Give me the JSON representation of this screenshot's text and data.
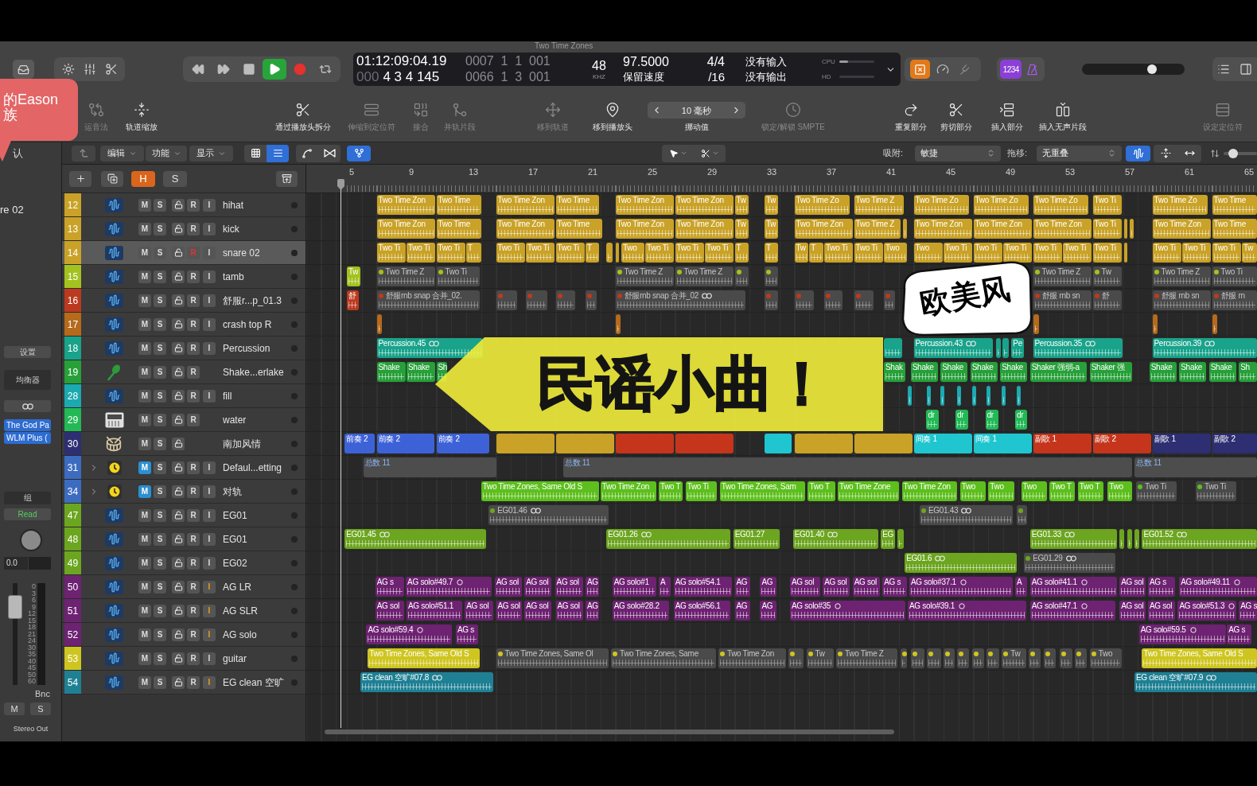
{
  "window": {
    "title": "Two Time Zones"
  },
  "control_bar": {
    "transport": [
      {
        "on": false
      },
      {
        "on": false
      },
      {
        "on": false
      },
      {
        "on": true
      },
      {
        "on": false
      },
      {
        "on": false
      }
    ],
    "lcd": {
      "time": "01:12:09:04.19",
      "position_dim": "000",
      "position": "4 3 4 145",
      "locators": [
        "0007  1  1  001",
        "0066  1  3  001"
      ],
      "sample_rate": "48",
      "sample_rate_unit": "KHZ",
      "tempo": "97.5000",
      "tempo_mode": "保留速度",
      "signature": "4/4",
      "division": "/16",
      "input": "没有输入",
      "output": "没有输出",
      "cpu": {
        "label": "CPU",
        "level": 0.25
      },
      "hd": {
        "label": "HD"
      }
    },
    "modes": [
      {
        "on": true
      },
      {
        "on": false
      },
      {
        "on": false
      }
    ],
    "count_in": {
      "label": "1234",
      "on": true
    },
    "metronome": {
      "on": true
    },
    "master_volume": {
      "level": 0.7
    }
  },
  "toolbar": [
    {
      "kind": "button",
      "label": "运音法",
      "disabled": true
    },
    {
      "kind": "button",
      "label": "轨道缩放",
      "disabled": false
    },
    {
      "kind": "button",
      "label": "通过播放头拆分",
      "disabled": false
    },
    {
      "kind": "button",
      "label": "伸缩到定位符",
      "disabled": true
    },
    {
      "kind": "button",
      "label": "接合",
      "disabled": true
    },
    {
      "kind": "button",
      "label": "并轨片段",
      "disabled": true
    },
    {
      "kind": "button",
      "label": "移到轨道",
      "disabled": true
    },
    {
      "kind": "button",
      "label": "移到播放头",
      "disabled": false
    },
    {
      "kind": "stepper",
      "value": "10 毫秒",
      "label": "挪动值"
    },
    {
      "kind": "button",
      "label": "锁定/解锁 SMPTE",
      "disabled": true
    },
    {
      "kind": "button",
      "label": "重复部分",
      "disabled": false
    },
    {
      "kind": "button",
      "label": "剪切部分",
      "disabled": false
    },
    {
      "kind": "button",
      "label": "插入部分",
      "disabled": false
    },
    {
      "kind": "button",
      "label": "插入无声片段",
      "disabled": false
    },
    {
      "kind": "button",
      "label": "设定定位符",
      "disabled": true
    }
  ],
  "edit_bar": {
    "menus": [
      "编辑",
      "功能",
      "显示"
    ],
    "views": [
      {
        "selected": false
      },
      {
        "selected": true
      }
    ],
    "catch": {
      "on": true
    },
    "snap_label": "吸附:",
    "snap": "敏捷",
    "drag_label": "拖移:",
    "drag": "无重叠",
    "waveform_zoom": {
      "on": true
    },
    "zoom": {
      "level": 0.2
    }
  },
  "inspector": {
    "title": "认",
    "track": "re 02",
    "settings": "设置",
    "eq": "均衡器",
    "plugins": [
      "The God Pa",
      "WLM Plus ("
    ],
    "group": "组",
    "automation": "Read",
    "volume": "0.0",
    "fader": {
      "level": 0.85
    },
    "scale": [
      "0",
      "3",
      "6",
      "9",
      "12",
      "15",
      "18",
      "21",
      "24",
      "30",
      "35",
      "40",
      "45",
      "50",
      "60"
    ],
    "bounce": "Bnc",
    "mute": {
      "label": "M",
      "on": false
    },
    "solo": {
      "label": "S",
      "on": false
    },
    "output": "Stereo Out"
  },
  "list_header": {
    "buttons": [
      {
        "label": "H",
        "on": true
      },
      {
        "label": "S",
        "on": false
      }
    ]
  },
  "ruler": [
    "5",
    "9",
    "13",
    "17",
    "21",
    "25",
    "29",
    "33",
    "37",
    "41",
    "45",
    "49",
    "53",
    "57",
    "61",
    "65"
  ],
  "tracks": [
    {
      "number": "12",
      "name": "hihat",
      "kind": "audio",
      "color": "#c9a227",
      "selected": false,
      "mute": {
        "label": "M",
        "on": false
      },
      "solo": {
        "label": "S",
        "on": false
      },
      "record": {
        "label": "R",
        "on": false
      },
      "input": {
        "label": "I",
        "on": false
      },
      "regions": [
        {
          "label": "Two Time Zon",
          "muted": false
        },
        {
          "label": "Two Time",
          "muted": false
        },
        {
          "label": "Two Time Zon",
          "muted": false
        },
        {
          "label": "Two Time",
          "muted": false
        },
        {
          "label": "Two Time Zon",
          "muted": false
        },
        {
          "label": "Two Time Zon",
          "muted": false
        },
        {
          "label": "Tw",
          "muted": false
        },
        {
          "label": "Tw",
          "muted": false
        },
        {
          "label": "Two Time Zo",
          "muted": false
        },
        {
          "label": "Two Time Z",
          "muted": false
        },
        {
          "label": "Two Time Zo",
          "muted": false
        },
        {
          "label": "Two Time Zo",
          "muted": false
        },
        {
          "label": "Two Time Zo",
          "muted": false
        },
        {
          "label": "Two Ti",
          "muted": false
        },
        {
          "label": "Two Time Zo",
          "muted": false
        },
        {
          "label": "Two Time",
          "muted": false
        }
      ]
    },
    {
      "number": "13",
      "name": "kick",
      "kind": "audio",
      "color": "#c9a227",
      "selected": false,
      "mute": {
        "label": "M",
        "on": false
      },
      "solo": {
        "label": "S",
        "on": false
      },
      "record": {
        "label": "R",
        "on": false
      },
      "input": {
        "label": "I",
        "on": false
      },
      "regions": [
        {
          "label": "Two Time Zon",
          "muted": false
        },
        {
          "label": "Two Time",
          "muted": false
        },
        {
          "label": "Two Time Zon",
          "muted": false
        },
        {
          "label": "Two Time",
          "muted": false
        },
        {
          "label": "Two Time Zon",
          "muted": false
        },
        {
          "label": "Two Time Zon",
          "muted": false
        },
        {
          "label": "Tw",
          "muted": false
        },
        {
          "label": "Tw",
          "muted": false
        },
        {
          "label": "Two Time Zon",
          "muted": false
        },
        {
          "label": "Two Time Z",
          "muted": false
        },
        {
          "muted": false
        },
        {
          "label": "Two Time Zon",
          "muted": false
        },
        {
          "label": "Two Time Zon",
          "muted": false
        },
        {
          "label": "Two Time Zon",
          "muted": false
        },
        {
          "label": "Two Ti",
          "muted": false
        },
        {
          "muted": false
        },
        {
          "muted": false
        },
        {
          "label": "Two Time Zon",
          "muted": false
        },
        {
          "label": "Two Time",
          "muted": false
        }
      ]
    },
    {
      "number": "14",
      "name": "snare 02",
      "kind": "audio",
      "color": "#c9a227",
      "selected": true,
      "mute": {
        "label": "M",
        "on": false
      },
      "solo": {
        "label": "S",
        "on": false
      },
      "record": {
        "label": "R",
        "on": true
      },
      "input": {
        "label": "I",
        "on": false
      },
      "regions": [
        {
          "label": "Two Ti",
          "muted": false
        },
        {
          "label": "Two Ti",
          "muted": false
        },
        {
          "label": "Two Ti",
          "muted": false
        },
        {
          "label": "T",
          "muted": false
        },
        {
          "label": "Two Ti",
          "muted": false
        },
        {
          "label": "Two Ti",
          "muted": false
        },
        {
          "label": "Two Ti",
          "muted": false
        },
        {
          "label": "T",
          "muted": false
        },
        {
          "muted": false
        },
        {
          "muted": false
        },
        {
          "label": "Two",
          "muted": false
        },
        {
          "label": "Two Ti",
          "muted": false
        },
        {
          "label": "Two Ti",
          "muted": false
        },
        {
          "label": "Two Ti",
          "muted": false
        },
        {
          "label": "T",
          "muted": false
        },
        {
          "label": "T",
          "muted": false
        },
        {
          "label": "Tw",
          "muted": false
        },
        {
          "label": "T",
          "muted": false
        },
        {
          "label": "Two Ti",
          "muted": false
        },
        {
          "label": "Two Ti",
          "muted": false
        },
        {
          "label": "Two",
          "muted": false
        },
        {
          "label": "Two",
          "muted": false
        },
        {
          "label": "Two Ti",
          "muted": false
        },
        {
          "label": "Two Ti",
          "muted": false
        },
        {
          "label": "Two Ti",
          "muted": false
        },
        {
          "label": "Two Ti",
          "muted": false
        },
        {
          "label": "Two Ti",
          "muted": false
        },
        {
          "label": "Two Ti",
          "muted": false
        },
        {
          "muted": false
        },
        {
          "label": "Two Ti",
          "muted": false
        },
        {
          "label": "Two Ti",
          "muted": false
        },
        {
          "label": "Two Ti",
          "muted": false
        },
        {
          "label": "Tw",
          "muted": false
        }
      ]
    },
    {
      "number": "15",
      "name": "tamb",
      "kind": "audio",
      "color": "#a3c21f",
      "selected": false,
      "mute": {
        "label": "M",
        "on": false
      },
      "solo": {
        "label": "S",
        "on": false
      },
      "record": {
        "label": "R",
        "on": false
      },
      "input": {
        "label": "I",
        "on": false
      },
      "regions": [
        {
          "label": "Tw",
          "muted": false
        },
        {
          "label": "Two Time Z",
          "muted": true
        },
        {
          "label": "Two Ti",
          "muted": true
        },
        {
          "label": "Two Time Z",
          "muted": true
        },
        {
          "label": "Two Time Z",
          "muted": true
        },
        {
          "muted": true
        },
        {
          "muted": true
        },
        {
          "label": "Two Time Z",
          "muted": true
        },
        {
          "label": "Tw",
          "muted": true
        },
        {
          "label": "Two Time Z",
          "muted": true
        },
        {
          "label": "Two Ti",
          "muted": true
        }
      ]
    },
    {
      "number": "16",
      "name": "舒服r...p_01.3",
      "kind": "audio",
      "color": "#bb3a1f",
      "selected": false,
      "mute": {
        "label": "M",
        "on": false
      },
      "solo": {
        "label": "S",
        "on": false
      },
      "record": {
        "label": "R",
        "on": false
      },
      "input": {
        "label": "I",
        "on": false
      },
      "regions": [
        {
          "label": "舒",
          "muted": false
        },
        {
          "label": "舒服rnb snap 合并_02.",
          "muted": true
        },
        {
          "muted": true
        },
        {
          "muted": true
        },
        {
          "muted": true
        },
        {
          "muted": true
        },
        {
          "label": "舒服rnb snap 合并_02",
          "muted": true,
          "double_ring": true
        },
        {
          "muted": true
        },
        {
          "muted": true
        },
        {
          "muted": true
        },
        {
          "muted": true
        },
        {
          "muted": true
        },
        {
          "label": "舒服 rnb sn",
          "muted": true
        },
        {
          "label": "舒",
          "muted": true
        },
        {
          "label": "舒服 rnb sn",
          "muted": true
        },
        {
          "label": "舒服 rn",
          "muted": true
        }
      ]
    },
    {
      "number": "17",
      "name": "crash top R",
      "kind": "audio",
      "color": "#b56a1c",
      "selected": false,
      "mute": {
        "label": "M",
        "on": false
      },
      "solo": {
        "label": "S",
        "on": false
      },
      "record": {
        "label": "R",
        "on": false
      },
      "input": {
        "label": "I",
        "on": false
      },
      "regions": [
        {
          "muted": false
        },
        {
          "muted": false
        },
        {
          "muted": false
        },
        {
          "muted": false
        },
        {
          "muted": false
        }
      ]
    },
    {
      "number": "18",
      "name": "Percussion",
      "kind": "audio",
      "color": "#19a38b",
      "selected": false,
      "mute": {
        "label": "M",
        "on": false
      },
      "solo": {
        "label": "S",
        "on": false
      },
      "record": {
        "label": "R",
        "on": false
      },
      "input": {
        "label": "I",
        "on": false
      },
      "regions": [
        {
          "label": "Percussion.45",
          "muted": false,
          "double_ring": true
        },
        {
          "muted": false
        },
        {
          "label": "Percussion.43",
          "muted": false,
          "double_ring": true
        },
        {
          "muted": false
        },
        {
          "muted": false
        },
        {
          "label": "Pe",
          "muted": false
        },
        {
          "label": "Percussion.35",
          "muted": false,
          "double_ring": true
        },
        {
          "label": "Percussion.39",
          "muted": false,
          "double_ring": true
        }
      ]
    },
    {
      "number": "19",
      "name": "Shake...erlake",
      "kind": "shaker",
      "color": "#27a03a",
      "selected": false,
      "mute": {
        "label": "M",
        "on": false
      },
      "solo": {
        "label": "S",
        "on": false
      },
      "record": {
        "label": "R",
        "on": false
      },
      "regions": [
        {
          "label": "Shake",
          "muted": false
        },
        {
          "label": "Shake",
          "muted": false
        },
        {
          "label": "Sh",
          "muted": false
        },
        {
          "label": "Shak",
          "muted": false
        },
        {
          "label": "Shake",
          "muted": false
        },
        {
          "label": "Shake",
          "muted": false
        },
        {
          "label": "Shake",
          "muted": false
        },
        {
          "label": "Shake",
          "muted": false
        },
        {
          "label": "Shaker 强弱-a",
          "muted": false
        },
        {
          "label": "Shaker 强",
          "muted": false
        },
        {
          "label": "Shake",
          "muted": false
        },
        {
          "label": "Shake",
          "muted": false
        },
        {
          "label": "Shake",
          "muted": false
        },
        {
          "label": "Sh",
          "muted": false
        }
      ]
    },
    {
      "number": "28",
      "name": "fill",
      "kind": "audio",
      "color": "#1aaab0",
      "selected": false,
      "mute": {
        "label": "M",
        "on": false
      },
      "solo": {
        "label": "S",
        "on": false
      },
      "record": {
        "label": "R",
        "on": false
      },
      "input": {
        "label": "I",
        "on": false
      },
      "regions": [
        {
          "muted": false
        },
        {
          "muted": false
        },
        {
          "muted": false
        },
        {
          "muted": false
        },
        {
          "muted": false
        },
        {
          "muted": false
        },
        {
          "muted": false
        },
        {
          "muted": false
        }
      ]
    },
    {
      "number": "29",
      "name": "water",
      "kind": "sampler",
      "color": "#22b956",
      "selected": false,
      "mute": {
        "label": "M",
        "on": false
      },
      "solo": {
        "label": "S",
        "on": false
      },
      "record": {
        "label": "R",
        "on": false
      },
      "regions": [
        {
          "label": "dr",
          "muted": false
        },
        {
          "label": "dr",
          "muted": false
        },
        {
          "label": "dr",
          "muted": false
        },
        {
          "label": "dr",
          "muted": false
        }
      ]
    },
    {
      "number": "30",
      "name": "南加风情",
      "kind": "drummer",
      "color": "#2e2e72",
      "selected": false,
      "mute": {
        "label": "M",
        "on": false
      },
      "solo": {
        "label": "S",
        "on": false
      },
      "regions": [
        {
          "label": "前奏 2",
          "muted": false,
          "color": "#3d62d8"
        },
        {
          "label": "前奏 2",
          "muted": false,
          "color": "#3d62d8"
        },
        {
          "label": "前奏 2",
          "muted": false,
          "color": "#3d62d8"
        },
        {
          "muted": false,
          "color": "#c9a227"
        },
        {
          "muted": false,
          "color": "#c9a227"
        },
        {
          "muted": false,
          "color": "#c4351c"
        },
        {
          "muted": false,
          "color": "#c4351c"
        },
        {
          "muted": false,
          "color": "#1fc6cf"
        },
        {
          "muted": false,
          "color": "#c9a227"
        },
        {
          "muted": false,
          "color": "#c9a227"
        },
        {
          "label": "间奏 1",
          "muted": false,
          "color": "#1fc6cf"
        },
        {
          "label": "间奏 1",
          "muted": false,
          "color": "#1fc6cf"
        },
        {
          "label": "副歌 1",
          "muted": false,
          "color": "#c4351c"
        },
        {
          "label": "副歌 2",
          "muted": false,
          "color": "#c4351c"
        },
        {
          "label": "副歌 1",
          "muted": false,
          "color": "#2e2e72"
        },
        {
          "label": "副歌 2",
          "muted": false,
          "color": "#2e2e72"
        }
      ]
    },
    {
      "number": "31",
      "name": "Defaul...etting",
      "kind": "folder",
      "color": "#3c6cc0",
      "selected": false,
      "expanded": false,
      "mute": {
        "label": "M",
        "on": true
      },
      "solo": {
        "label": "S",
        "on": false
      },
      "record": {
        "label": "R",
        "on": false
      },
      "input": {
        "label": "I",
        "on": false
      },
      "regions": [
        {
          "label": "总数 11",
          "muted": false
        },
        {
          "label": "总数 11",
          "muted": false
        },
        {
          "label": "总数 11",
          "muted": false
        }
      ]
    },
    {
      "number": "34",
      "name": "对轨",
      "kind": "summing",
      "color": "#3c6cc0",
      "selected": false,
      "expanded": false,
      "mute": {
        "label": "M",
        "on": true
      },
      "solo": {
        "label": "S",
        "on": false
      },
      "record": {
        "label": "R",
        "on": false
      },
      "input": {
        "label": "I",
        "on": false
      },
      "regions": [
        {
          "label": "Two Time Zones, Same Old S",
          "muted": false,
          "color": "#5dbf1d"
        },
        {
          "label": "Two Time Zon",
          "muted": false,
          "color": "#5dbf1d"
        },
        {
          "label": "Two T",
          "muted": false,
          "color": "#5dbf1d"
        },
        {
          "label": "Two Ti",
          "muted": false,
          "color": "#5dbf1d"
        },
        {
          "label": "Two Time Zones, Sam",
          "muted": false,
          "color": "#5dbf1d"
        },
        {
          "label": "Two T",
          "muted": false,
          "color": "#5dbf1d"
        },
        {
          "label": "Two Time Zone",
          "muted": false,
          "color": "#5dbf1d"
        },
        {
          "label": "Two Time Zon",
          "muted": false,
          "color": "#5dbf1d"
        },
        {
          "label": "Two",
          "muted": false,
          "color": "#5dbf1d"
        },
        {
          "label": "Two",
          "muted": false,
          "color": "#5dbf1d"
        },
        {
          "label": "Two",
          "muted": false,
          "color": "#5dbf1d"
        },
        {
          "label": "Two T",
          "muted": false,
          "color": "#5dbf1d"
        },
        {
          "label": "Two T",
          "muted": false,
          "color": "#5dbf1d"
        },
        {
          "label": "Two",
          "muted": false,
          "color": "#5dbf1d"
        },
        {
          "label": "Two Ti",
          "muted": true,
          "color": "#5dbf1d"
        },
        {
          "label": "Two Ti",
          "muted": true,
          "color": "#5dbf1d"
        }
      ]
    },
    {
      "number": "47",
      "name": "EG01",
      "kind": "audio",
      "color": "#6ca51f",
      "selected": false,
      "mute": {
        "label": "M",
        "on": false
      },
      "solo": {
        "label": "S",
        "on": false
      },
      "record": {
        "label": "R",
        "on": false
      },
      "input": {
        "label": "I",
        "on": false
      },
      "regions": [
        {
          "label": "EG01.46",
          "muted": true,
          "double_ring": true
        },
        {
          "label": "EG01.43",
          "muted": true,
          "double_ring": true
        },
        {
          "muted": true
        }
      ]
    },
    {
      "number": "48",
      "name": "EG01",
      "kind": "audio",
      "color": "#6ca51f",
      "selected": false,
      "mute": {
        "label": "M",
        "on": false
      },
      "solo": {
        "label": "S",
        "on": false
      },
      "record": {
        "label": "R",
        "on": false
      },
      "input": {
        "label": "I",
        "on": false
      },
      "regions": [
        {
          "label": "EG01.45",
          "muted": false,
          "double_ring": true
        },
        {
          "label": "EG01.26",
          "muted": false,
          "double_ring": true
        },
        {
          "label": "EG01.27",
          "muted": false
        },
        {
          "label": "EG01.40",
          "muted": false,
          "double_ring": true
        },
        {
          "label": "EG",
          "muted": false
        },
        {
          "muted": false
        },
        {
          "label": "EG01.33",
          "muted": false,
          "double_ring": true
        },
        {
          "muted": false
        },
        {
          "muted": false
        },
        {
          "muted": false
        },
        {
          "label": "EG01.52",
          "muted": false,
          "double_ring": true
        }
      ]
    },
    {
      "number": "49",
      "name": "EG02",
      "kind": "audio",
      "color": "#6ca51f",
      "selected": false,
      "mute": {
        "label": "M",
        "on": false
      },
      "solo": {
        "label": "S",
        "on": false
      },
      "record": {
        "label": "R",
        "on": false
      },
      "input": {
        "label": "I",
        "on": false
      },
      "regions": [
        {
          "label": "EG01.6",
          "muted": false,
          "double_ring": true
        },
        {
          "label": "EG01.29",
          "muted": true,
          "double_ring": true
        }
      ]
    },
    {
      "number": "50",
      "name": "AG LR",
      "kind": "audio",
      "color": "#6e2272",
      "selected": false,
      "mute": {
        "label": "M",
        "on": false
      },
      "solo": {
        "label": "S",
        "on": false
      },
      "record": {
        "label": "R",
        "on": false
      },
      "input": {
        "label": "I",
        "on": true
      },
      "regions": [
        {
          "label": "AG s",
          "muted": false
        },
        {
          "label": "AG solo#49.7",
          "muted": false,
          "circle_mark": true
        },
        {
          "label": "AG sol",
          "muted": false
        },
        {
          "label": "AG sol",
          "muted": false
        },
        {
          "label": "AG sol",
          "muted": false
        },
        {
          "label": "AG",
          "muted": false
        },
        {
          "label": "AG solo#1",
          "muted": false
        },
        {
          "label": "A",
          "muted": false
        },
        {
          "label": "AG solo#54.1",
          "muted": false
        },
        {
          "label": "AG",
          "muted": false
        },
        {
          "label": "AG",
          "muted": false
        },
        {
          "label": "AG sol",
          "muted": false
        },
        {
          "label": "AG sol",
          "muted": false
        },
        {
          "label": "AG sol",
          "muted": false
        },
        {
          "label": "AG s",
          "muted": false
        },
        {
          "label": "AG solo#37.1",
          "muted": false,
          "circle_mark": true
        },
        {
          "label": "A",
          "muted": false
        },
        {
          "label": "AG solo#41.1",
          "muted": false,
          "circle_mark": true
        },
        {
          "label": "AG sol",
          "muted": false
        },
        {
          "label": "AG s",
          "muted": false
        },
        {
          "label": "AG solo#49.11",
          "muted": false,
          "circle_mark": true
        }
      ]
    },
    {
      "number": "51",
      "name": "AG SLR",
      "kind": "audio",
      "color": "#6e2272",
      "selected": false,
      "mute": {
        "label": "M",
        "on": false
      },
      "solo": {
        "label": "S",
        "on": false
      },
      "record": {
        "label": "R",
        "on": false
      },
      "input": {
        "label": "I",
        "on": true
      },
      "regions": [
        {
          "label": "AG sol",
          "muted": false
        },
        {
          "label": "AG solo#51.1",
          "muted": false
        },
        {
          "label": "AG sol",
          "muted": false
        },
        {
          "label": "AG sol",
          "muted": false
        },
        {
          "label": "AG sol",
          "muted": false
        },
        {
          "label": "AG sol",
          "muted": false
        },
        {
          "label": "AG",
          "muted": false
        },
        {
          "label": "AG solo#28.2",
          "muted": false
        },
        {
          "label": "AG solo#56.1",
          "muted": false
        },
        {
          "label": "AG",
          "muted": false
        },
        {
          "label": "AG",
          "muted": false
        },
        {
          "label": "AG solo#35",
          "muted": false,
          "circle_mark": true
        },
        {
          "label": "AG solo#39.1",
          "muted": false,
          "circle_mark": true
        },
        {
          "label": "AG solo#47.1",
          "muted": false,
          "circle_mark": true
        },
        {
          "label": "AG sol",
          "muted": false
        },
        {
          "label": "AG sol",
          "muted": false
        },
        {
          "label": "AG solo#51.3",
          "muted": false,
          "circle_mark": true
        },
        {
          "label": "AG s",
          "muted": false
        }
      ]
    },
    {
      "number": "52",
      "name": "AG solo",
      "kind": "audio",
      "color": "#6e2272",
      "selected": false,
      "mute": {
        "label": "M",
        "on": false
      },
      "solo": {
        "label": "S",
        "on": false
      },
      "record": {
        "label": "R",
        "on": false
      },
      "input": {
        "label": "I",
        "on": true
      },
      "regions": [
        {
          "label": "AG solo#59.4",
          "muted": false,
          "circle_mark": true
        },
        {
          "label": "AG s",
          "muted": false
        },
        {
          "label": "AG solo#59.5",
          "muted": false,
          "circle_mark": true
        },
        {
          "label": "AG s",
          "muted": false
        }
      ]
    },
    {
      "number": "53",
      "name": "guitar",
      "kind": "audio",
      "color": "#cfc520",
      "selected": false,
      "mute": {
        "label": "M",
        "on": false
      },
      "solo": {
        "label": "S",
        "on": false
      },
      "record": {
        "label": "R",
        "on": false
      },
      "input": {
        "label": "I",
        "on": false
      },
      "regions": [
        {
          "label": "Two Time Zones, Same Old S",
          "muted": false
        },
        {
          "label": "Two Time Zones, Same Ol",
          "muted": true
        },
        {
          "label": "Two Time Zones, Same",
          "muted": true
        },
        {
          "label": "Two Time Zon",
          "muted": true
        },
        {
          "muted": true
        },
        {
          "label": "Tw",
          "muted": true
        },
        {
          "label": "Two Time Z",
          "muted": true
        },
        {
          "muted": true
        },
        {
          "muted": true
        },
        {
          "muted": true
        },
        {
          "muted": true
        },
        {
          "muted": true
        },
        {
          "muted": true
        },
        {
          "muted": true
        },
        {
          "label": "Tw",
          "muted": true
        },
        {
          "muted": true
        },
        {
          "muted": true
        },
        {
          "muted": true
        },
        {
          "muted": true
        },
        {
          "label": "Two",
          "muted": true
        },
        {
          "label": "Two Time Zones, Same Old S",
          "muted": false
        }
      ]
    },
    {
      "number": "54",
      "name": "EG clean 空旷",
      "kind": "audio",
      "color": "#1f8094",
      "selected": false,
      "mute": {
        "label": "M",
        "on": false
      },
      "solo": {
        "label": "S",
        "on": false
      },
      "record": {
        "label": "R",
        "on": false
      },
      "input": {
        "label": "I",
        "on": true
      },
      "regions": [
        {
          "label": "EG clean 空旷#07.8",
          "muted": false,
          "double_ring": true
        },
        {
          "label": "EG clean 空旷#07.9",
          "muted": false,
          "double_ring": true
        }
      ]
    }
  ],
  "stickers": {
    "callout": [
      "的Eason",
      "族"
    ],
    "banner": "民谣小曲！",
    "cloud": "欧美风"
  }
}
